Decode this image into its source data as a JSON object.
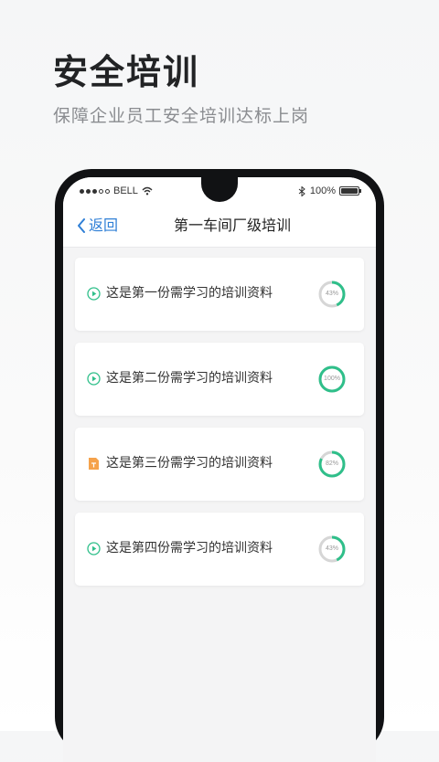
{
  "hero": {
    "title": "安全培训",
    "subtitle": "保障企业员工安全培训达标上岗"
  },
  "status_bar": {
    "carrier": "BELL",
    "battery": "100%",
    "signal_icon": "signal-dots-icon",
    "wifi_icon": "wifi-icon",
    "bluetooth_icon": "bluetooth-icon",
    "battery_icon": "battery-icon"
  },
  "nav": {
    "back_label": "返回",
    "title": "第一车间厂级培训"
  },
  "colors": {
    "accent_green": "#2fbf8a",
    "doc_orange": "#f5a24b",
    "link_blue": "#2f7fd6",
    "ring_track": "#d6d6d6"
  },
  "items": [
    {
      "title": "这是第一份需学习的培训资料",
      "icon": "play-icon",
      "progress": 43,
      "progress_label": "43%"
    },
    {
      "title": "这是第二份需学习的培训资料",
      "icon": "play-icon",
      "progress": 100,
      "progress_label": "100%"
    },
    {
      "title": "这是第三份需学习的培训资料",
      "icon": "document-icon",
      "progress": 82,
      "progress_label": "82%"
    },
    {
      "title": "这是第四份需学习的培训资料",
      "icon": "play-icon",
      "progress": 43,
      "progress_label": "43%"
    }
  ]
}
